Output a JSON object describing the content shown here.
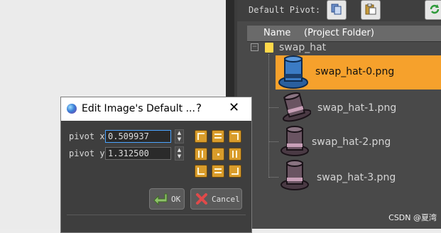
{
  "toolbar": {
    "default_pivot_label": "Default Pivot:",
    "buttons": [
      "copy-icon",
      "paste-icon",
      "refresh-icon"
    ]
  },
  "list_header": {
    "name": "Name",
    "folder": "(Project Folder)"
  },
  "tree": {
    "root": "swap_hat",
    "items": [
      {
        "label": "swap_hat-0.png",
        "selected": true
      },
      {
        "label": "swap_hat-1.png",
        "selected": false
      },
      {
        "label": "swap_hat-2.png",
        "selected": false
      },
      {
        "label": "swap_hat-3.png",
        "selected": false
      }
    ]
  },
  "dialog": {
    "title": "Edit Image's Default ...",
    "help": "?",
    "close": "✕",
    "pivot_x_label": "pivot x",
    "pivot_x_value": "0.509937",
    "pivot_y_label": "pivot y",
    "pivot_y_value": "1.312500",
    "ok_label": "OK",
    "cancel_label": "Cancel"
  },
  "watermark": "CSDN @夏湾",
  "colors": {
    "selection": "#f6a12c",
    "pivot_button": "#d99c2b",
    "panel": "#494949"
  }
}
